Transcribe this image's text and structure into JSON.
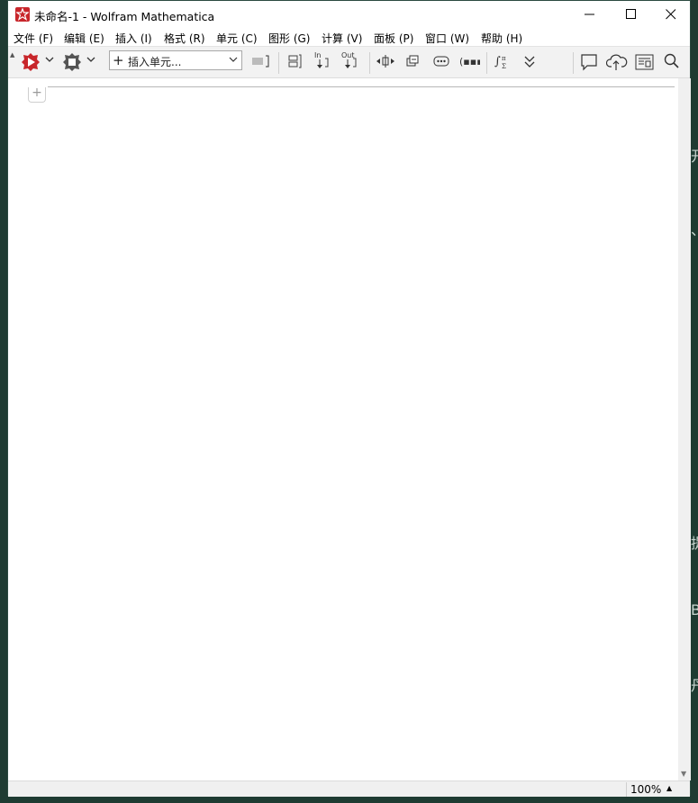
{
  "window": {
    "title": "未命名-1 - Wolfram Mathematica",
    "controls": {
      "minimize": "minimize-icon",
      "maximize": "maximize-icon",
      "close": "close-icon"
    }
  },
  "menu": [
    "文件 (F)",
    "编辑 (E)",
    "插入 (I)",
    "格式 (R)",
    "单元 (C)",
    "图形 (G)",
    "计算 (V)",
    "面板 (P)",
    "窗口 (W)",
    "帮助 (H)"
  ],
  "toolbar": {
    "insert_cell_label": "插入单元...",
    "icons": [
      "evaluate-icon",
      "chevron-down-icon",
      "kernel-icon",
      "chevron-down-icon",
      "cell-bracket-icon",
      "group-cells-icon",
      "in-icon",
      "out-icon",
      "drag-icon",
      "edit-icon",
      "more-icon",
      "ellipsis-icon",
      "formula-icon",
      "expand-icon",
      "comment-icon",
      "cloud-upload-icon",
      "notebook-icon",
      "search-icon"
    ]
  },
  "status": {
    "zoom": "100%"
  },
  "background_glyphs": [
    "开",
    "、",
    "提",
    "B",
    "丹"
  ],
  "colors": {
    "app_red": "#c8262b",
    "desktop": "#1f3b32",
    "toolbar": "#f2f2f2"
  }
}
